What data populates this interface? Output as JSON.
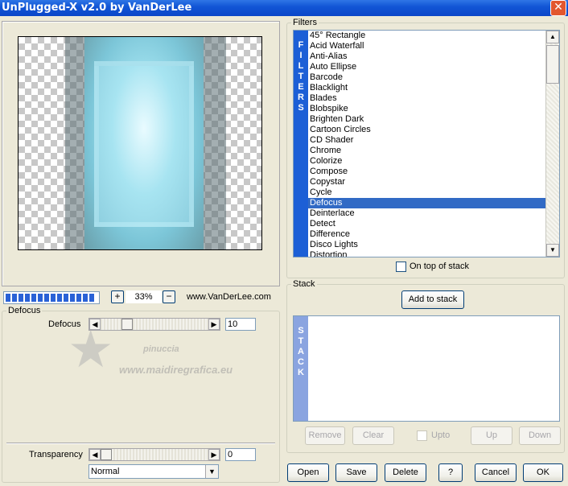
{
  "window": {
    "title": "UnPlugged-X v2.0 by VanDerLee",
    "close_glyph": "✕"
  },
  "preview": {
    "zoom_minus": "−",
    "zoom_plus": "+",
    "zoom": "33%",
    "site": "www.VanDerLee.com",
    "progress_fraction": 1.0
  },
  "settings": {
    "group_title": "Defocus",
    "defocus_label": "Defocus",
    "defocus_value": "10",
    "transparency_label": "Transparency",
    "transparency_value": "0",
    "blend_mode": "Normal"
  },
  "filters": {
    "group_title": "Filters",
    "tab_label": "FILTERS",
    "items": [
      "45° Rectangle",
      "Acid Waterfall",
      "Anti-Alias",
      "Auto Ellipse",
      "Barcode",
      "Blacklight",
      "Blades",
      "Blobspike",
      "Brighten Dark",
      "Cartoon Circles",
      "CD Shader",
      "Chrome",
      "Colorize",
      "Compose",
      "Copystar",
      "Cycle",
      "Defocus",
      "Deinterlace",
      "Detect",
      "Difference",
      "Disco Lights",
      "Distortion"
    ],
    "selected": "Defocus",
    "on_top_label": "On top of stack"
  },
  "stack": {
    "group_title": "Stack",
    "tab_label": "STACK",
    "add_label": "Add to stack",
    "remove_label": "Remove",
    "clear_label": "Clear",
    "upto_label": "Upto",
    "up_label": "Up",
    "down_label": "Down"
  },
  "footer": {
    "open_label": "Open",
    "save_label": "Save",
    "delete_label": "Delete",
    "help_label": "?",
    "cancel_label": "Cancel",
    "ok_label": "OK"
  },
  "watermark": {
    "line1": "pinuccia",
    "line2": "www.maidiregrafica.eu"
  },
  "colors": {
    "titlebar": "#0a46c8",
    "filters_tab": "#1c5fd6",
    "stack_tab": "#8aa4e0",
    "selection": "#316ac5"
  }
}
